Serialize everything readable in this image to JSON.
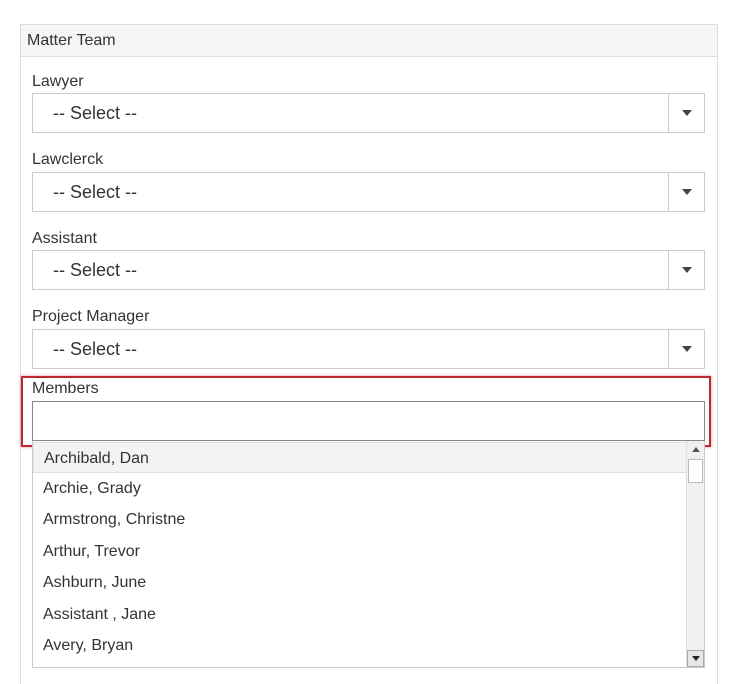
{
  "panel": {
    "title": "Matter Team"
  },
  "fields": {
    "lawyer": {
      "label": "Lawyer",
      "value": "-- Select --"
    },
    "lawclerck": {
      "label": "Lawclerck",
      "value": "-- Select --"
    },
    "assistant": {
      "label": "Assistant",
      "value": "-- Select --"
    },
    "project_manager": {
      "label": "Project Manager",
      "value": "-- Select --"
    }
  },
  "members": {
    "label": "Members",
    "value": "",
    "options": [
      "Archibald, Dan",
      "Archie, Grady",
      "Armstrong, Christne",
      "Arthur, Trevor",
      "Ashburn, June",
      "Assistant , Jane",
      "Avery, Bryan"
    ]
  },
  "colors": {
    "highlight": "#c0272d",
    "border": "#cccccc",
    "heading_bg": "#f5f5f5"
  },
  "icons": {
    "select_arrow": "caret-down-icon",
    "scroll_up": "scroll-up-arrow-icon",
    "scroll_down": "scroll-down-arrow-icon"
  }
}
